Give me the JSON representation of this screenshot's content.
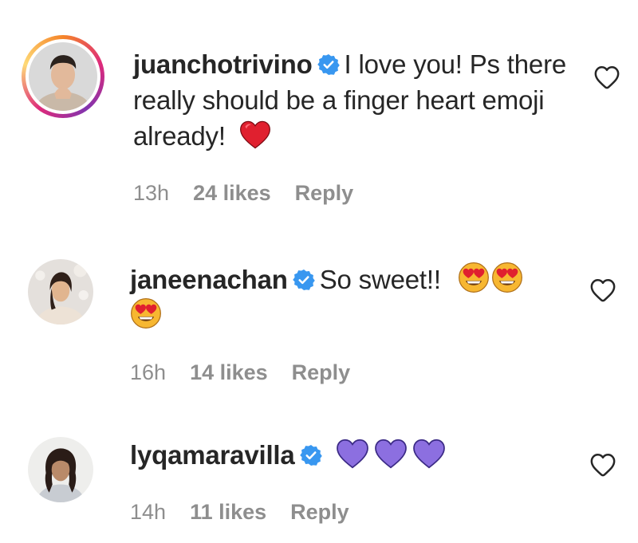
{
  "comments": [
    {
      "username": "juanchotrivino",
      "text": "I love you! Ps there really should be a finger heart emoji already!",
      "emojis": [
        "red-heart"
      ],
      "time": "13h",
      "likes": "24 likes",
      "reply": "Reply"
    },
    {
      "username": "janeenachan",
      "text": "So sweet!!",
      "emojis": [
        "heart-eyes",
        "heart-eyes",
        "heart-eyes"
      ],
      "time": "16h",
      "likes": "14 likes",
      "reply": "Reply"
    },
    {
      "username": "lyqamaravilla",
      "text": "",
      "emojis": [
        "purple-heart",
        "purple-heart",
        "purple-heart"
      ],
      "time": "14h",
      "likes": "11 likes",
      "reply": "Reply"
    }
  ],
  "colors": {
    "verified": "#3897f0",
    "meta_text": "#8e8e8e",
    "primary_text": "#262626",
    "red_heart": "#e0202f",
    "purple_heart": "#8c6fe0"
  }
}
